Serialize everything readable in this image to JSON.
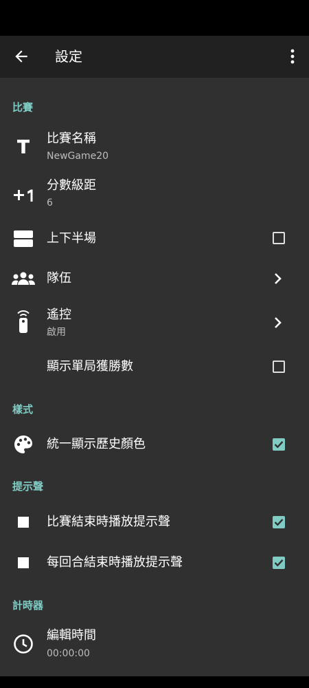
{
  "app_bar": {
    "title": "設定",
    "back_icon": "arrow-back-icon",
    "more_icon": "more-vert-icon"
  },
  "sections": {
    "match": {
      "header": "比賽",
      "game_name": {
        "title": "比賽名稱",
        "summary": "NewGame20",
        "icon": "text-format-icon"
      },
      "score_step": {
        "title": "分數級距",
        "summary": "6",
        "icon": "plus-one-icon"
      },
      "halves": {
        "title": "上下半場",
        "icon": "split-view-icon",
        "checked": false
      },
      "teams": {
        "title": "隊伍",
        "icon": "group-icon"
      },
      "remote": {
        "title": "遙控",
        "summary": "啟用",
        "icon": "remote-icon"
      },
      "show_set_wins": {
        "title": "顯示單局獲勝數",
        "checked": false
      }
    },
    "style": {
      "header": "樣式",
      "unified_history_color": {
        "title": "統一顯示歷史顏色",
        "icon": "palette-icon",
        "checked": true
      }
    },
    "sound": {
      "header": "提示聲",
      "match_end_sound": {
        "title": "比賽結束時播放提示聲",
        "icon": "stop-icon",
        "checked": true
      },
      "round_end_sound": {
        "title": "每回合結束時播放提示聲",
        "icon": "stop-icon",
        "checked": true
      }
    },
    "timer": {
      "header": "計時器",
      "edit_time": {
        "title": "編輯時間",
        "summary": "00:00:00",
        "icon": "clock-icon"
      }
    }
  },
  "colors": {
    "accent": "#80cbc4",
    "background": "#303030",
    "app_bar": "#212121"
  }
}
